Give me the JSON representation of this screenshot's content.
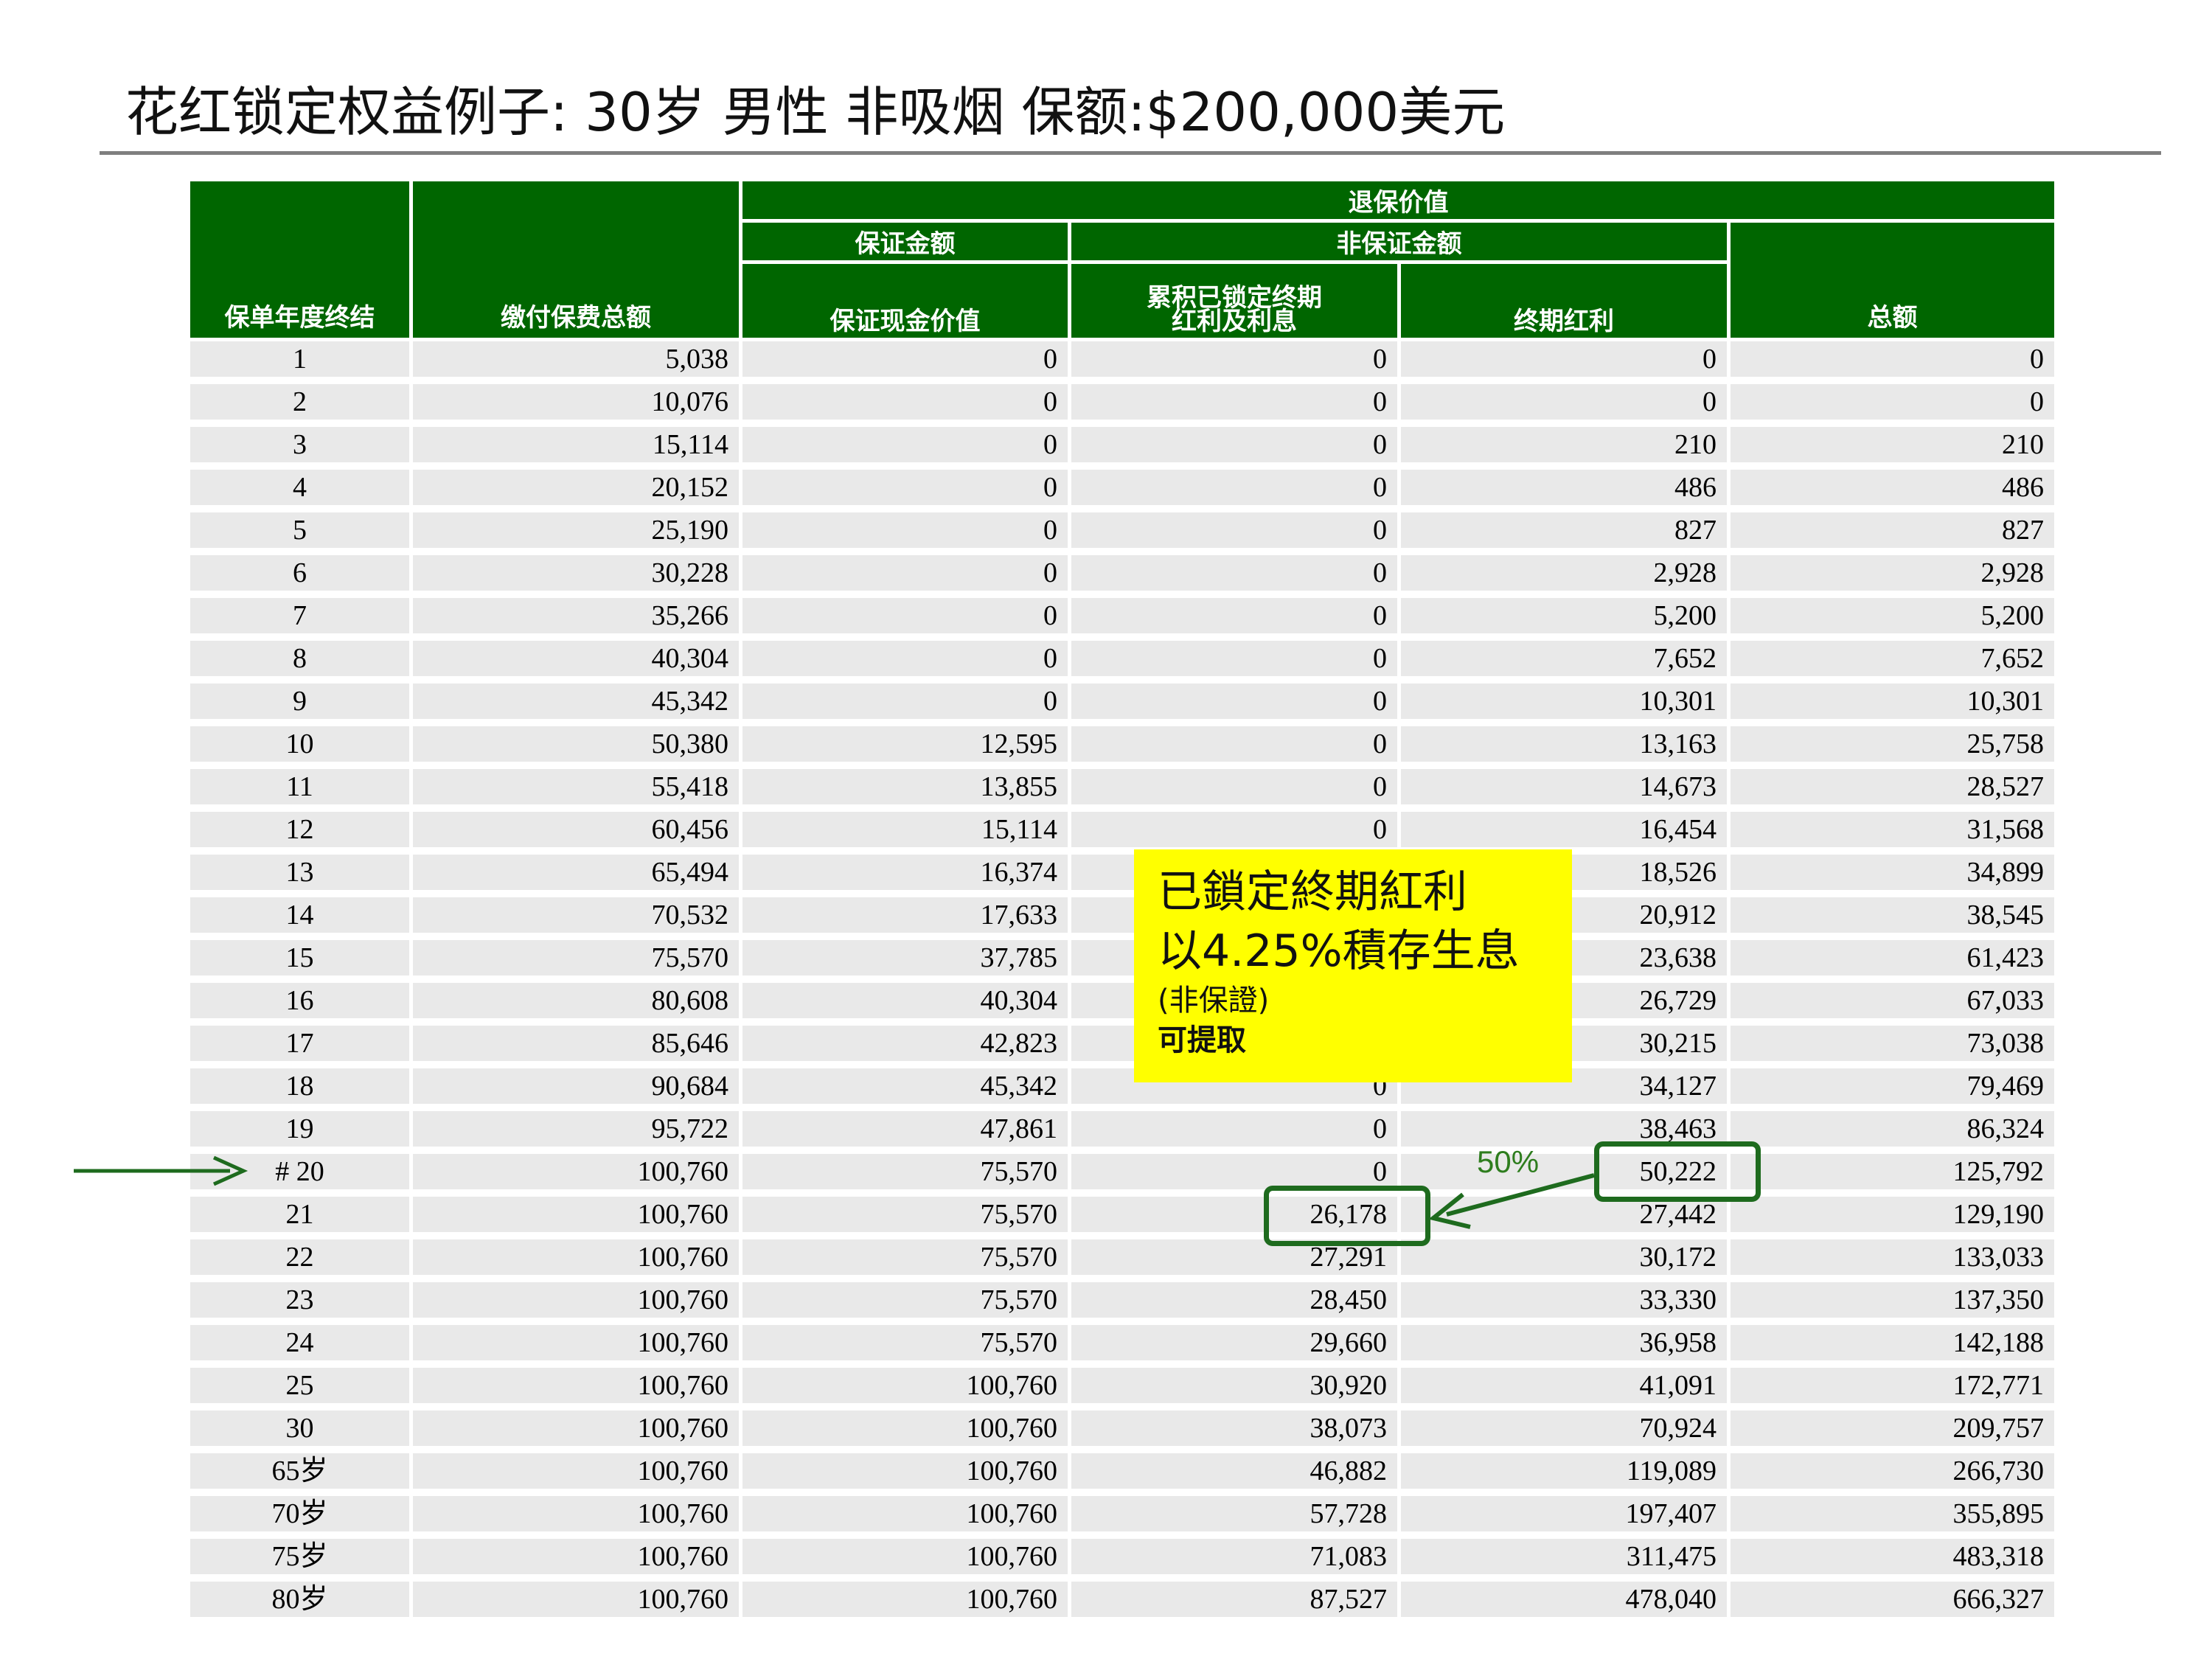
{
  "title": "花红锁定权益例子: 30岁  男性  非吸烟  保额:$200,000美元",
  "table": {
    "header": {
      "col_year": "保单年度终结",
      "col_premium": "缴付保费总额",
      "group_surrender": "退保价值",
      "group_guaranteed": "保证金额",
      "group_nonguaranteed": "非保证金额",
      "col_cash_value": "保证现金价值",
      "col_locked_line1": "累积已锁定终期",
      "col_locked_line2": "红利及利息",
      "col_terminal": "终期红利",
      "col_total": "总额"
    },
    "rows": [
      [
        "1",
        "5,038",
        "0",
        "0",
        "0",
        "0"
      ],
      [
        "2",
        "10,076",
        "0",
        "0",
        "0",
        "0"
      ],
      [
        "3",
        "15,114",
        "0",
        "0",
        "210",
        "210"
      ],
      [
        "4",
        "20,152",
        "0",
        "0",
        "486",
        "486"
      ],
      [
        "5",
        "25,190",
        "0",
        "0",
        "827",
        "827"
      ],
      [
        "6",
        "30,228",
        "0",
        "0",
        "2,928",
        "2,928"
      ],
      [
        "7",
        "35,266",
        "0",
        "0",
        "5,200",
        "5,200"
      ],
      [
        "8",
        "40,304",
        "0",
        "0",
        "7,652",
        "7,652"
      ],
      [
        "9",
        "45,342",
        "0",
        "0",
        "10,301",
        "10,301"
      ],
      [
        "10",
        "50,380",
        "12,595",
        "0",
        "13,163",
        "25,758"
      ],
      [
        "11",
        "55,418",
        "13,855",
        "0",
        "14,673",
        "28,527"
      ],
      [
        "12",
        "60,456",
        "15,114",
        "0",
        "16,454",
        "31,568"
      ],
      [
        "13",
        "65,494",
        "16,374",
        "",
        "18,526",
        "34,899"
      ],
      [
        "14",
        "70,532",
        "17,633",
        "",
        "20,912",
        "38,545"
      ],
      [
        "15",
        "75,570",
        "37,785",
        "",
        "23,638",
        "61,423"
      ],
      [
        "16",
        "80,608",
        "40,304",
        "",
        "26,729",
        "67,033"
      ],
      [
        "17",
        "85,646",
        "42,823",
        "",
        "30,215",
        "73,038"
      ],
      [
        "18",
        "90,684",
        "45,342",
        "0",
        "34,127",
        "79,469"
      ],
      [
        "19",
        "95,722",
        "47,861",
        "0",
        "38,463",
        "86,324"
      ],
      [
        "# 20",
        "100,760",
        "75,570",
        "0",
        "50,222",
        "125,792"
      ],
      [
        "21",
        "100,760",
        "75,570",
        "26,178",
        "27,442",
        "129,190"
      ],
      [
        "22",
        "100,760",
        "75,570",
        "27,291",
        "30,172",
        "133,033"
      ],
      [
        "23",
        "100,760",
        "75,570",
        "28,450",
        "33,330",
        "137,350"
      ],
      [
        "24",
        "100,760",
        "75,570",
        "29,660",
        "36,958",
        "142,188"
      ],
      [
        "25",
        "100,760",
        "100,760",
        "30,920",
        "41,091",
        "172,771"
      ],
      [
        "30",
        "100,760",
        "100,760",
        "38,073",
        "70,924",
        "209,757"
      ],
      [
        "65岁",
        "100,760",
        "100,760",
        "46,882",
        "119,089",
        "266,730"
      ],
      [
        "70岁",
        "100,760",
        "100,760",
        "57,728",
        "197,407",
        "355,895"
      ],
      [
        "75岁",
        "100,760",
        "100,760",
        "71,083",
        "311,475",
        "483,318"
      ],
      [
        "80岁",
        "100,760",
        "100,760",
        "87,527",
        "478,040",
        "666,327"
      ]
    ]
  },
  "callout": {
    "line1": "已鎖定終期紅利",
    "line2": "以4.25%積存生息",
    "line3": "(非保證)",
    "line4": "可提取"
  },
  "annotation": {
    "percent_label": "50%",
    "color": "#1e6b1e"
  },
  "colors": {
    "header_green": "#006600",
    "row_gray": "#e9e9e9",
    "callout_yellow": "#ffff00"
  }
}
